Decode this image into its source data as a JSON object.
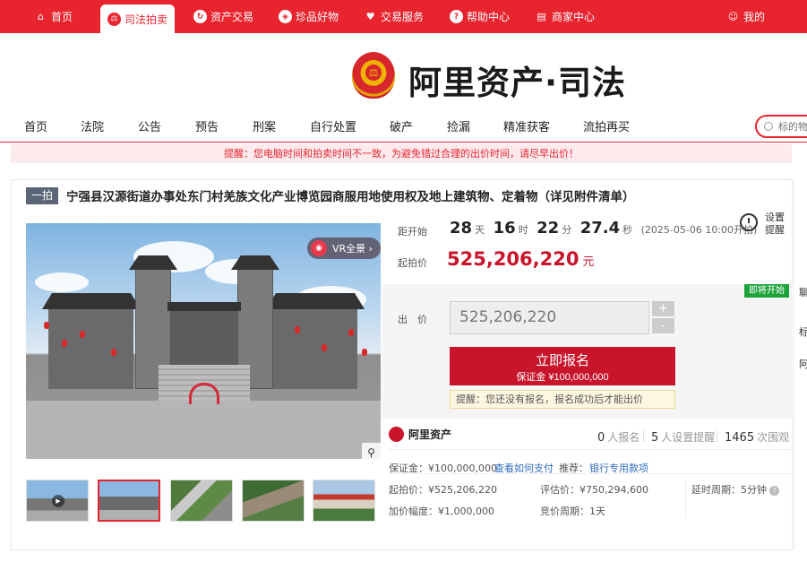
{
  "topbar": {
    "items": [
      {
        "label": "首页",
        "icon": "home-icon"
      },
      {
        "label": "司法拍卖",
        "icon": "gavel-icon",
        "active": true
      },
      {
        "label": "资产交易",
        "icon": "refresh-icon"
      },
      {
        "label": "珍品好物",
        "icon": "gem-icon"
      },
      {
        "label": "交易服务",
        "icon": "heart-icon"
      },
      {
        "label": "帮助中心",
        "icon": "help-icon"
      },
      {
        "label": "商家中心",
        "icon": "shop-icon"
      }
    ],
    "my_label": "我的",
    "bg_color": "#e8242f"
  },
  "logo": {
    "text": "阿里资产·司法"
  },
  "nav": {
    "items": [
      "首页",
      "法院",
      "公告",
      "预告",
      "刑案",
      "自行处置",
      "破产",
      "捡漏",
      "精准获客",
      "流拍再买"
    ],
    "search_placeholder": "标的物"
  },
  "notice": "提醒：您电脑时间和拍卖时间不一致，为避免错过合理的出价时间，请尽早出价！",
  "lot": {
    "tag": "一拍",
    "title": "宁强县汉源街道办事处东门村羌族文化产业博览园商服用地使用权及地上建筑物、定着物（详见附件清单）",
    "vr_label": "VR全景 ›"
  },
  "countdown": {
    "label": "距开始",
    "days": "28",
    "days_unit": "天",
    "hours": "16",
    "hours_unit": "时",
    "minutes": "22",
    "minutes_unit": "分",
    "seconds": "27.4",
    "seconds_unit": "秒",
    "start_time": "(2025-05-06 10:00开拍)"
  },
  "remind": {
    "line1": "设置",
    "line2": "提醒"
  },
  "price": {
    "label": "起拍价",
    "value": "525,206,220",
    "unit": "元"
  },
  "bid": {
    "badge": "即将开始",
    "label": "出　价",
    "input_value": "525,206,220",
    "plus": "+",
    "minus": "-",
    "apply_label": "立即报名",
    "deposit_line": "保证金 ¥100,000,000",
    "tip": "提醒：您还没有报名，报名成功后才能出价"
  },
  "stats": {
    "brand": "阿里资产",
    "applicants_num": "0",
    "applicants_label": "人报名",
    "reminders_num": "5",
    "reminders_label": "人设置提醒",
    "views_num": "1465",
    "views_label": "次围观"
  },
  "details": {
    "deposit": "保证金：¥100,000,000",
    "how_to_pay": "查看如何支付",
    "recommend_label": "推荐：",
    "recommend_link": "银行专用款项",
    "start_price": "起拍价：¥525,206,220",
    "appraisal": "评估价：¥750,294,600",
    "delay": "延时周期：5分钟",
    "increment": "加价幅度：¥1,000,000",
    "cycle": "竞价周期：1天"
  },
  "side": {
    "a": "聊",
    "b": "标",
    "c": "阿"
  }
}
